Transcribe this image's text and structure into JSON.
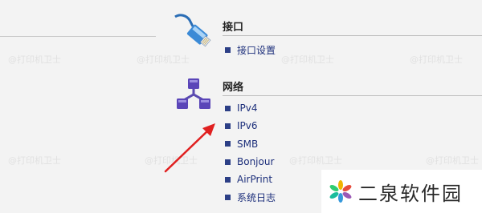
{
  "interface_section": {
    "title": "接口",
    "icon": "cable-icon",
    "items": [
      {
        "label": "接口设置"
      }
    ]
  },
  "network_section": {
    "title": "网络",
    "icon": "network-icon",
    "items": [
      {
        "label": "IPv4"
      },
      {
        "label": "IPv6"
      },
      {
        "label": "SMB"
      },
      {
        "label": "Bonjour"
      },
      {
        "label": "AirPrint"
      },
      {
        "label": "系统日志"
      }
    ]
  },
  "watermark": {
    "text": "@打印机卫士"
  },
  "brand": {
    "text": "二泉软件园"
  },
  "colors": {
    "link": "#1d2f7b",
    "bullet": "#2c3f86",
    "arrow": "#e02020",
    "background": "#f3f3f3"
  }
}
